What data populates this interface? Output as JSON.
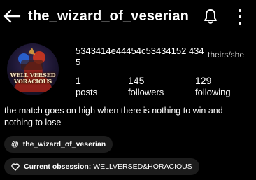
{
  "header": {
    "title": "the_wizard_of_veserian",
    "back_icon": "back-arrow-icon",
    "notification_icon": "bell-icon",
    "more_icon": "more-vertical-icon"
  },
  "profile": {
    "avatar_text_line1": "WELL VERSED",
    "avatar_text_line2": "VORACIOUS",
    "display_name": "5343414e44454c53434152 4345",
    "pronouns": "theirs/she"
  },
  "stats": [
    {
      "count": "1",
      "label": "posts"
    },
    {
      "count": "145",
      "label": "followers"
    },
    {
      "count": "129",
      "label": "following"
    }
  ],
  "bio": "the match goes on high when there is nothing to win and nothing to lose",
  "threads_link": {
    "icon": "threads-at-icon",
    "handle": "the_wizard_of_veserian"
  },
  "obsession": {
    "icon": "heart-icon",
    "label": "Current obsession:",
    "value": "WELLVERSED&HORACIOUS"
  }
}
